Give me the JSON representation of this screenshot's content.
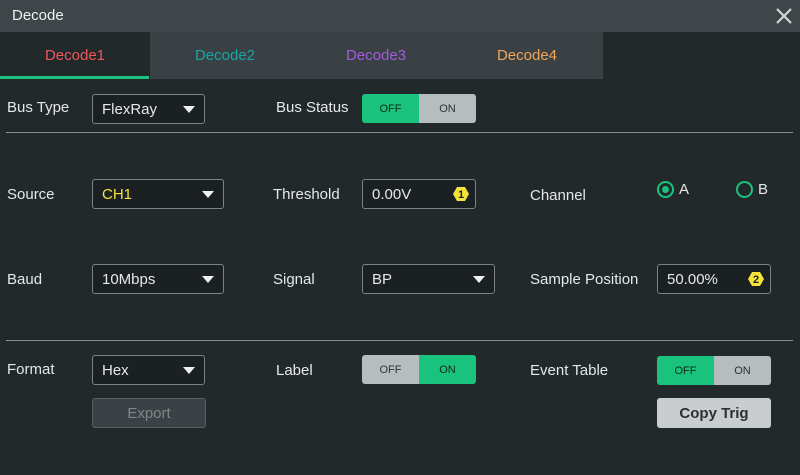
{
  "window": {
    "title": "Decode"
  },
  "tabs": [
    {
      "label": "Decode1",
      "color": "#f0565a"
    },
    {
      "label": "Decode2",
      "color": "#1aa6a6"
    },
    {
      "label": "Decode3",
      "color": "#a45be0"
    },
    {
      "label": "Decode4",
      "color": "#f2a65a"
    }
  ],
  "bus_type": {
    "label": "Bus Type",
    "value": "FlexRay"
  },
  "bus_status": {
    "label": "Bus Status",
    "off": "OFF",
    "on": "ON",
    "state": "OFF"
  },
  "source": {
    "label": "Source",
    "value": "CH1",
    "value_color": "#f5e33b"
  },
  "threshold": {
    "label": "Threshold",
    "value": "0.00V",
    "badge": "1"
  },
  "channel": {
    "label": "Channel",
    "options": [
      "A",
      "B"
    ],
    "selected": "A"
  },
  "baud": {
    "label": "Baud",
    "value": "10Mbps"
  },
  "signal": {
    "label": "Signal",
    "value": "BP"
  },
  "sample_position": {
    "label": "Sample Position",
    "value": "50.00%",
    "badge": "2"
  },
  "format": {
    "label": "Format",
    "value": "Hex"
  },
  "label_toggle": {
    "label": "Label",
    "off": "OFF",
    "on": "ON",
    "state": "ON"
  },
  "event_table": {
    "label": "Event Table",
    "off": "OFF",
    "on": "ON",
    "state": "OFF"
  },
  "buttons": {
    "export": "Export",
    "copy_trig": "Copy Trig"
  },
  "colors": {
    "accent": "#19c37d",
    "badge": "#f5e33b"
  }
}
